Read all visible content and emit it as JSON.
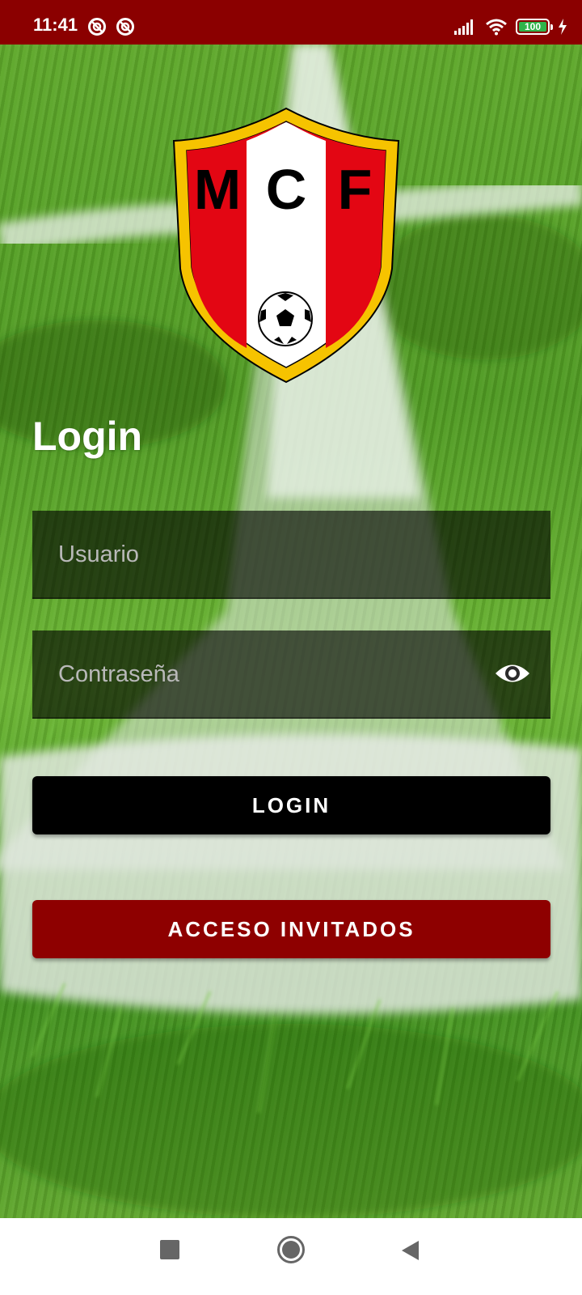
{
  "status_bar": {
    "time": "11:41",
    "notification_icons": [
      "app-notification-icon",
      "app-notification-icon"
    ],
    "system_icons": [
      "signal-icon",
      "wifi-icon",
      "battery-icon",
      "charging-icon"
    ],
    "battery_level": "100",
    "battery_fraction": 1.0,
    "background_color": "#8b0000"
  },
  "logo": {
    "letters": [
      "M",
      "C",
      "F"
    ],
    "colors": {
      "border": "#f6c300",
      "red": "#e30613",
      "white": "#ffffff"
    }
  },
  "login": {
    "title": "Login",
    "username_placeholder": "Usuario",
    "password_placeholder": "Contraseña",
    "password_toggle_icon": "eye-icon",
    "login_button_label": "LOGIN",
    "guest_button_label": "ACCESO INVITADOS",
    "colors": {
      "login_button": "#000000",
      "guest_button": "#8e0000"
    }
  },
  "nav_bar": {
    "items": [
      "recent-apps-icon",
      "home-icon",
      "back-icon"
    ]
  }
}
